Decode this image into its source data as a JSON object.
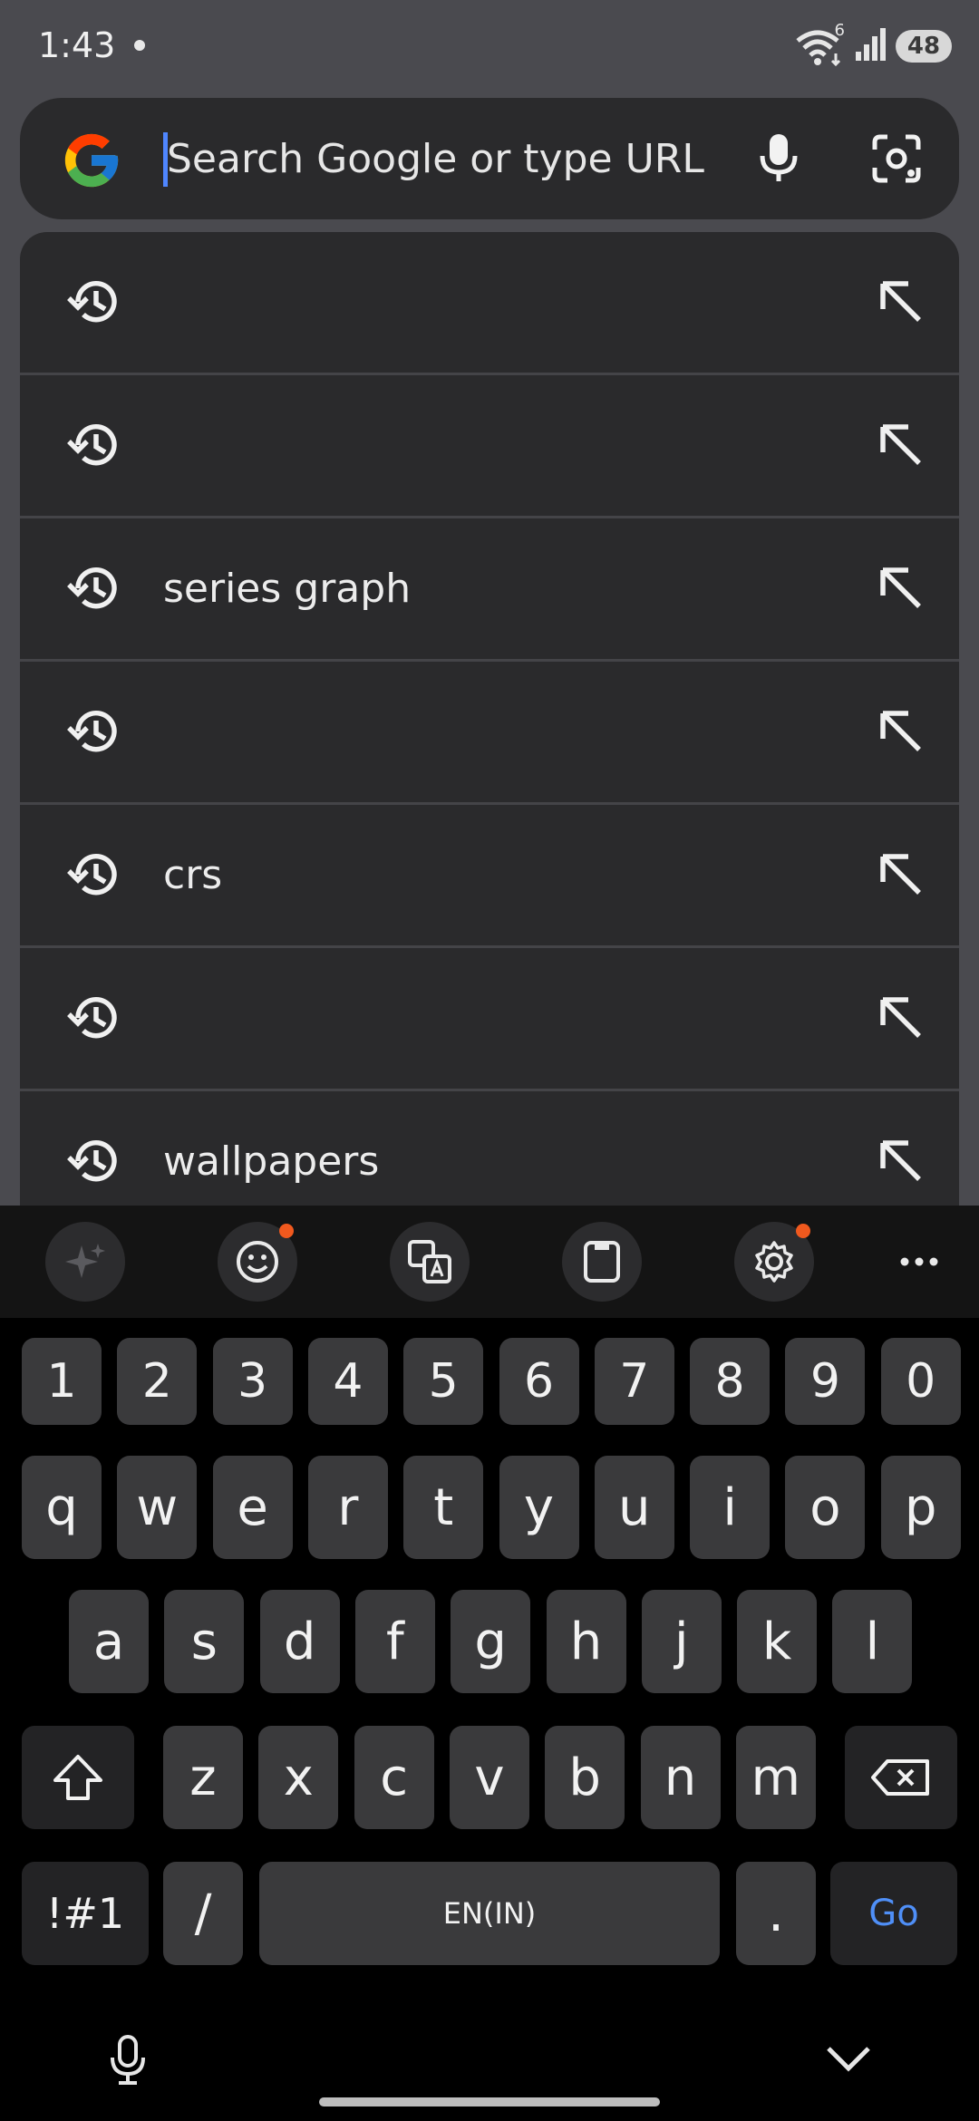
{
  "status": {
    "time": "1:43",
    "wifi_badge": "6",
    "battery": "48"
  },
  "search": {
    "placeholder": "Search Google or type URL",
    "mic_icon": "mic-icon",
    "lens_icon": "lens-camera-icon"
  },
  "suggestions": [
    {
      "text": ""
    },
    {
      "text": ""
    },
    {
      "text": "series graph"
    },
    {
      "text": ""
    },
    {
      "text": "crs"
    },
    {
      "text": ""
    },
    {
      "text": "wallpapers"
    }
  ],
  "keyboard": {
    "toolbar": [
      "ai-sparkle-icon",
      "emoji-icon",
      "translate-icon",
      "clipboard-icon",
      "gear-icon",
      "more-icon"
    ],
    "number_row": [
      "1",
      "2",
      "3",
      "4",
      "5",
      "6",
      "7",
      "8",
      "9",
      "0"
    ],
    "row1": [
      "q",
      "w",
      "e",
      "r",
      "t",
      "y",
      "u",
      "i",
      "o",
      "p"
    ],
    "row2": [
      "a",
      "s",
      "d",
      "f",
      "g",
      "h",
      "j",
      "k",
      "l"
    ],
    "row3": [
      "z",
      "x",
      "c",
      "v",
      "b",
      "n",
      "m"
    ],
    "symbols_label": "!#1",
    "slash_label": "/",
    "space_label": "EN(IN)",
    "period_label": ".",
    "go_label": "Go"
  },
  "colors": {
    "accent": "#4f86ff",
    "go": "#4f8ff7",
    "notification": "#f0591e"
  }
}
